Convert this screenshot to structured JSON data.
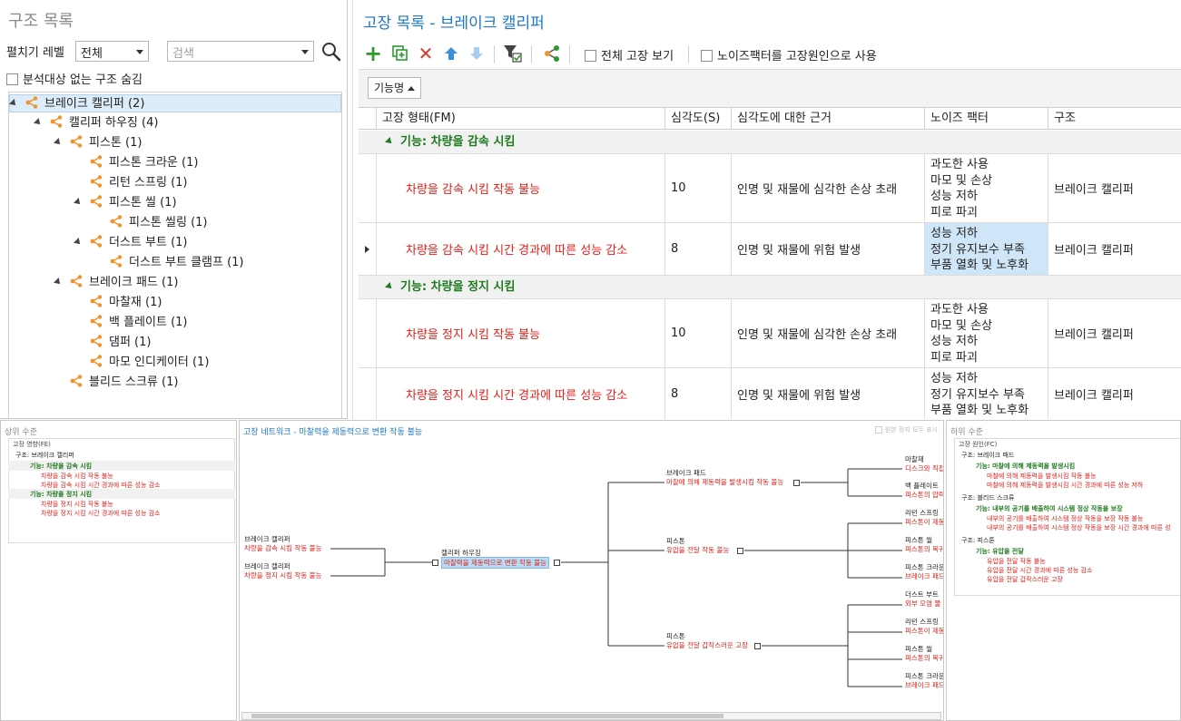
{
  "structure_panel": {
    "title": "구조 목록",
    "expand_level_label": "펼치기 레벨",
    "expand_level_value": "전체",
    "search_placeholder": "검색",
    "hide_checkbox_label": "분석대상 없는 구조 숨김",
    "tree": [
      {
        "label": "브레이크 캘리퍼 (2)",
        "depth": 0,
        "expanded": true,
        "selected": true
      },
      {
        "label": "캘리퍼 하우징 (4)",
        "depth": 1,
        "expanded": true
      },
      {
        "label": "피스톤 (1)",
        "depth": 2,
        "expanded": true
      },
      {
        "label": "피스톤 크라운 (1)",
        "depth": 3
      },
      {
        "label": "리턴 스프링 (1)",
        "depth": 3
      },
      {
        "label": "피스톤 씰 (1)",
        "depth": 3,
        "expanded": true
      },
      {
        "label": "피스톤 씰링 (1)",
        "depth": 4
      },
      {
        "label": "더스트 부트 (1)",
        "depth": 3,
        "expanded": true
      },
      {
        "label": "더스트 부트 클램프 (1)",
        "depth": 4
      },
      {
        "label": "브레이크 패드 (1)",
        "depth": 2,
        "expanded": true
      },
      {
        "label": "마찰재 (1)",
        "depth": 3
      },
      {
        "label": "백 플레이트 (1)",
        "depth": 3
      },
      {
        "label": "댐퍼 (1)",
        "depth": 3
      },
      {
        "label": "마모 인디케이터 (1)",
        "depth": 3
      },
      {
        "label": "블리드 스크류 (1)",
        "depth": 2
      }
    ]
  },
  "failure_panel": {
    "title": "고장 목록 - 브레이크 캘리퍼",
    "toolbar": {
      "show_all_label": "전체 고장 보기",
      "noise_as_cause_label": "노이즈팩터를 고장원인으로 사용"
    },
    "group_by_label": "기능명",
    "columns": [
      "고장 형태(FM)",
      "심각도(S)",
      "심각도에 대한 근거",
      "노이즈 팩터",
      "구조"
    ],
    "groups": [
      {
        "label": "기능: 차량을 감속 시킴",
        "rows": [
          {
            "fm": "차량을 감속 시킴 작동 불능",
            "severity": "10",
            "reason": "인명 및 재물에 심각한 손상 초래",
            "noise": [
              "과도한 사용",
              "마모 및 손상",
              "성능 저하",
              "피로 파괴"
            ],
            "structure": "브레이크 캘리퍼"
          },
          {
            "fm": "차량을 감속 시킴 시간 경과에 따른 성능 감소",
            "severity": "8",
            "reason": "인명 및 재물에 위험 발생",
            "noise": [
              "성능 저하",
              "정기 유지보수 부족",
              "부품 열화 및 노후화"
            ],
            "structure": "브레이크 캘리퍼",
            "current": true
          }
        ]
      },
      {
        "label": "기능: 차량을 정지 시킴",
        "rows": [
          {
            "fm": "차량을 정지 시킴 작동 불능",
            "severity": "10",
            "reason": "인명 및 재물에 심각한 손상 초래",
            "noise": [
              "과도한 사용",
              "마모 및 손상",
              "성능 저하",
              "피로 파괴"
            ],
            "structure": "브레이크 캘리퍼"
          },
          {
            "fm": "차량을 정지 시킴 시간 경과에 따른 성능 감소",
            "severity": "8",
            "reason": "인명 및 재물에 위험 발생",
            "noise": [
              "성능 저하",
              "정기 유지보수 부족",
              "부품 열화 및 노후화"
            ],
            "structure": "브레이크 캘리퍼"
          }
        ]
      }
    ]
  },
  "upper_level": {
    "title": "상위 수준",
    "header": "고장 영향(FE)",
    "structure": "구조: 브레이크 캘리퍼",
    "groups": [
      {
        "label": "기능: 차량을 감속 시킴",
        "items": [
          "차량을 감속 시킴 작동 불능",
          "차량을 감속 시킴 시간 경과에 따른 성능 감소"
        ]
      },
      {
        "label": "기능: 차량을 정지 시킴",
        "items": [
          "차량을 정지 시킴 작동 불능",
          "차량을 정지 시킴 시간 경과에 따른 성능 감소"
        ]
      }
    ]
  },
  "network": {
    "title": "고장 네트워크 - 마찰력을 제동력으로 변환 작동 불능",
    "show_all_label": "원본 정지 모두 표시",
    "left_nodes": [
      {
        "structure": "브레이크 캘리퍼",
        "failure": "차량을 감속 시킴 작동 불능"
      },
      {
        "structure": "브레이크 캘리퍼",
        "failure": "차량을 정지 시킴 작동 불능"
      }
    ],
    "center_node": {
      "structure": "캘리퍼 하우징",
      "failure": "마찰력을 제동력으로 변환 작동 불능"
    },
    "mid_nodes": [
      {
        "structure": "브레이크 패드",
        "failure": "마찰에 의해 제동력을 발생시킴 작동 불능"
      },
      {
        "structure": "피스톤",
        "failure": "유압을 전달 작동 불능"
      },
      {
        "structure": "피스톤",
        "failure": "유압을 전달 갑작스러운 고장"
      }
    ],
    "right_nodes": [
      {
        "structure": "마찰재",
        "failure": "디스크와 직접"
      },
      {
        "structure": "백 플레이트",
        "failure": "피스톤의 압력"
      },
      {
        "structure": "리턴 스프링",
        "failure": "피스톤이 제동"
      },
      {
        "structure": "피스톤 씰",
        "failure": "피스톤의 복귀"
      },
      {
        "structure": "피스톤 크라운",
        "failure": "브레이크 패드"
      },
      {
        "structure": "더스트 부트",
        "failure": "외부 오염 물"
      },
      {
        "structure": "리턴 스프링",
        "failure": "피스톤이 제동"
      },
      {
        "structure": "피스톤 씰",
        "failure": "피스톤의 복귀"
      },
      {
        "structure": "피스톤 크라운",
        "failure": "브레이크 패드"
      }
    ]
  },
  "lower_level": {
    "title": "하위 수준",
    "header": "고장 원인(FC)",
    "structures": [
      {
        "label": "구조: 브레이크 패드",
        "function": "기능: 마찰에 의해 제동력을 발생시킴",
        "items": [
          "마찰에 의해 제동력을 발생시킴 작동 불능",
          "마찰에 의해 제동력을 발생시킴 시간 경과에 따른 성능 저하"
        ]
      },
      {
        "label": "구조: 블리드 스크류",
        "function": "기능: 내부의 공기를 배출하여 시스템 정상 작동을 보장",
        "items": [
          "내부의 공기를 배출하여 시스템 정상 작동을 보장 작동 불능",
          "내부의 공기를 배출하여 시스템 정상 작동을 보장 시간 경과에 따른 성"
        ]
      },
      {
        "label": "구조: 피스톤",
        "function": "기능: 유압을 전달",
        "items": [
          "유압을 전달 작동 불능",
          "유압을 전달 시간 경과에 따른 성능 감소",
          "유압을 전달 갑작스러운 고장"
        ]
      }
    ]
  },
  "colors": {
    "accent": "#1e78c8",
    "failure_red": "#e0201a",
    "function_green": "#1f7a1f",
    "share_orange": "#f0932a",
    "selection": "#dcecf9"
  }
}
